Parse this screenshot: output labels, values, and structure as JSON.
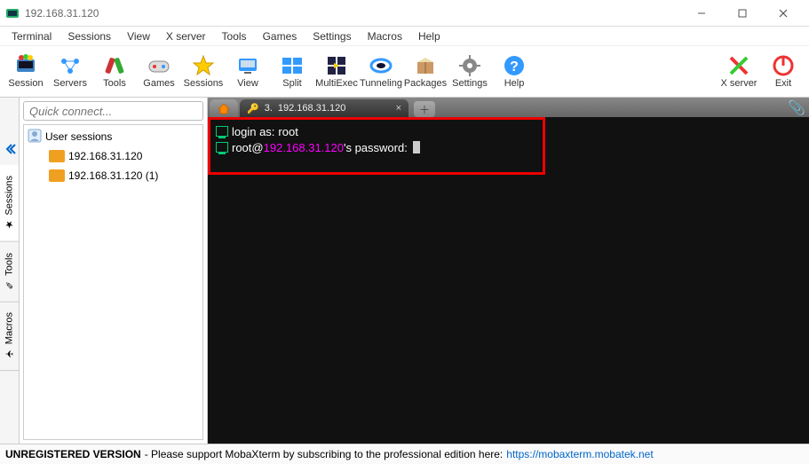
{
  "window": {
    "title": "192.168.31.120"
  },
  "menu": {
    "items": [
      "Terminal",
      "Sessions",
      "View",
      "X server",
      "Tools",
      "Games",
      "Settings",
      "Macros",
      "Help"
    ]
  },
  "toolbar": {
    "items": [
      {
        "label": "Session",
        "icon": "session"
      },
      {
        "label": "Servers",
        "icon": "servers"
      },
      {
        "label": "Tools",
        "icon": "tools"
      },
      {
        "label": "Games",
        "icon": "games"
      },
      {
        "label": "Sessions",
        "icon": "sessions-star"
      },
      {
        "label": "View",
        "icon": "view"
      },
      {
        "label": "Split",
        "icon": "split"
      },
      {
        "label": "MultiExec",
        "icon": "multiexec"
      },
      {
        "label": "Tunneling",
        "icon": "tunneling"
      },
      {
        "label": "Packages",
        "icon": "packages"
      },
      {
        "label": "Settings",
        "icon": "settings"
      },
      {
        "label": "Help",
        "icon": "help"
      }
    ],
    "right": [
      {
        "label": "X server",
        "icon": "xserver"
      },
      {
        "label": "Exit",
        "icon": "exit"
      }
    ]
  },
  "quick_connect": {
    "placeholder": "Quick connect..."
  },
  "side_tabs": [
    "Sessions",
    "Tools",
    "Macros"
  ],
  "sessions_tree": {
    "root": "User sessions",
    "children": [
      {
        "label": "192.168.31.120"
      },
      {
        "label": "192.168.31.120 (1)"
      }
    ]
  },
  "tabs": {
    "active": {
      "index": "3.",
      "label": "192.168.31.120"
    }
  },
  "terminal": {
    "line1_prefix": "login as:",
    "line1_value": "root",
    "line2_user": "root",
    "line2_host": "192.168.31.120",
    "line2_suffix": "'s password:"
  },
  "status": {
    "strong": "UNREGISTERED VERSION",
    "text": "- Please support MobaXterm by subscribing to the professional edition here:",
    "link": "https://mobaxterm.mobatek.net"
  }
}
